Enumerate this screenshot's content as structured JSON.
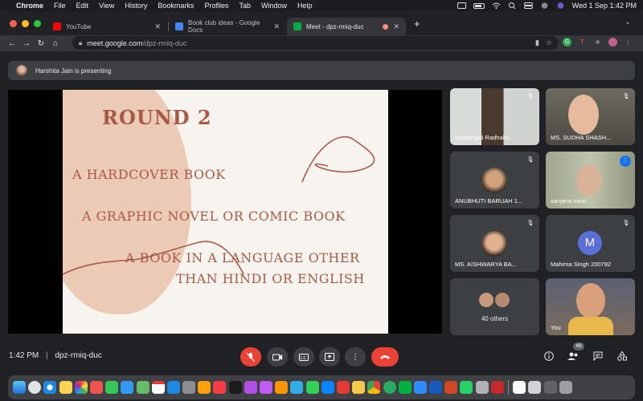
{
  "menubar": {
    "app": "Chrome",
    "menus": [
      "File",
      "Edit",
      "View",
      "History",
      "Bookmarks",
      "Profiles",
      "Tab",
      "Window",
      "Help"
    ],
    "clock": "Wed 1 Sep  1:42 PM"
  },
  "tabs": [
    {
      "title": "YouTube",
      "favicon": "youtube-icon",
      "color": "#ff0000"
    },
    {
      "title": "Book club ideas - Google Docs",
      "favicon": "google-docs-icon",
      "color": "#4285f4"
    },
    {
      "title": "Meet - dpz-rmiq-duc",
      "favicon": "google-meet-icon",
      "color": "#00ac47"
    }
  ],
  "address": {
    "domain": "meet.google.com",
    "path": "/dpz-rmiq-duc"
  },
  "meet": {
    "presenting_text": "Harshita Jain is presenting",
    "slide": {
      "title": "ROUND 2",
      "options": [
        "A HARDCOVER BOOK",
        "A GRAPHIC NOVEL OR COMIC BOOK",
        "A BOOK IN A LANGUAGE OTHER",
        "THAN HINDI OR ENGLISH"
      ]
    },
    "participants": [
      {
        "name": "Sumangali Radhakri...",
        "muted": true
      },
      {
        "name": "MS. SUDHA SHASH...",
        "muted": true
      },
      {
        "name": "ANUBHUTI BARUAH 1...",
        "muted": true
      },
      {
        "name": "sanjana sarin",
        "muted": false,
        "speaking": true
      },
      {
        "name": "MS. AISHWARYA BA...",
        "muted": true
      },
      {
        "name": "Mahima Singh 200792",
        "muted": true,
        "initial": "M"
      },
      {
        "name": "40 others"
      },
      {
        "name": "You"
      }
    ],
    "bottom": {
      "time": "1:42 PM",
      "separator": "|",
      "meeting_code": "dpz-rmiq-duc",
      "participant_count": "48"
    }
  }
}
